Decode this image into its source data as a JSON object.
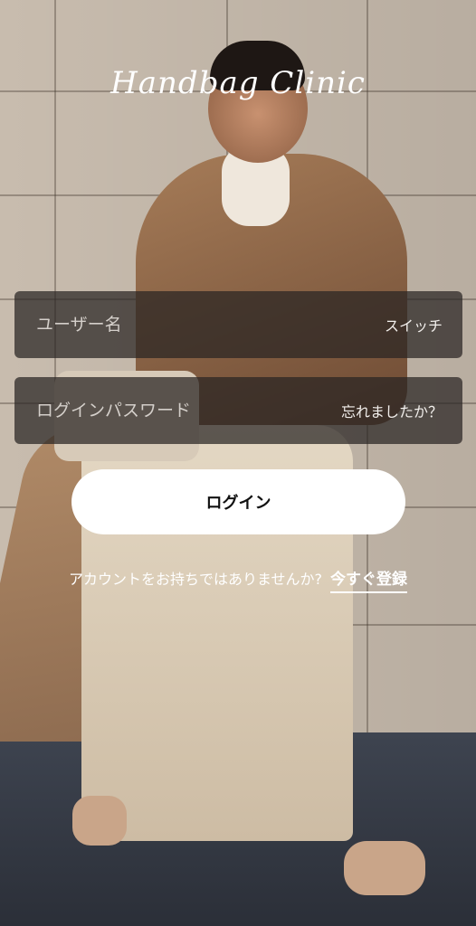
{
  "app": {
    "logo_text": "Handbag Clinic"
  },
  "login_form": {
    "username": {
      "placeholder": "ユーザー名",
      "value": "",
      "action_label": "スイッチ"
    },
    "password": {
      "placeholder": "ログインパスワード",
      "value": "",
      "action_label": "忘れましたか？"
    },
    "submit_label": "ログイン"
  },
  "signup": {
    "prompt": "アカウントをお持ちではありませんか?",
    "link_label": "今すぐ登録"
  }
}
